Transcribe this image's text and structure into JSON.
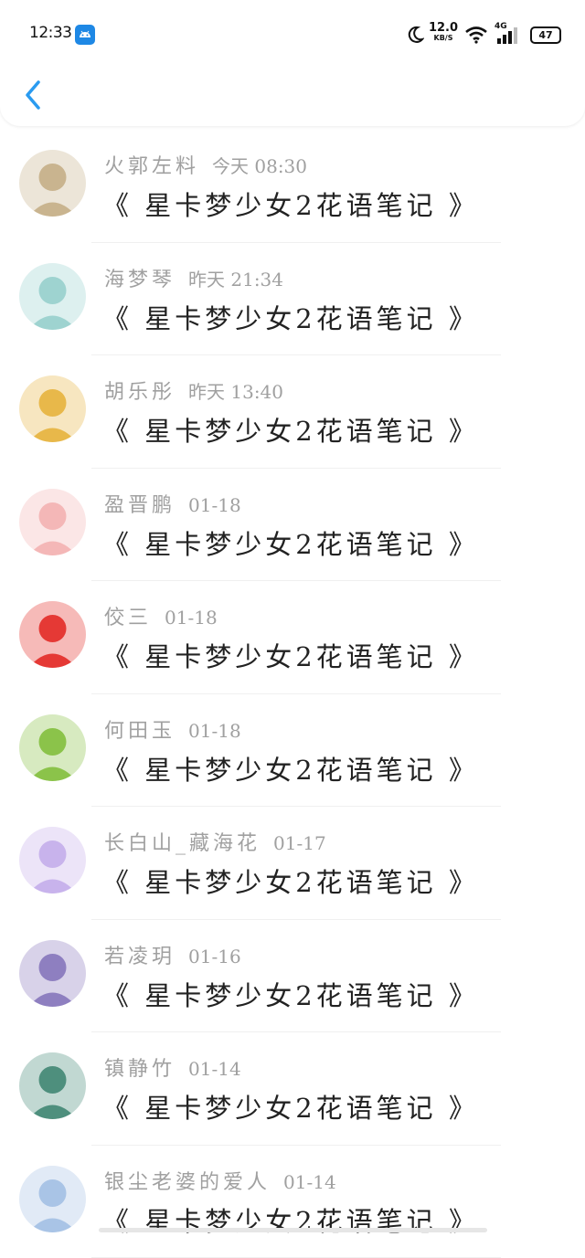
{
  "status_bar": {
    "time": "12:33",
    "net_speed": "12.0",
    "net_unit": "KB/S",
    "network_type": "4G",
    "battery": "47",
    "icons": [
      "android-app-icon",
      "moon-icon",
      "wifi-icon",
      "signal-icon",
      "battery-icon"
    ]
  },
  "header": {
    "back_icon": "chevron-left-icon",
    "accent": "#2a9bf0"
  },
  "messages": [
    {
      "name": "火郭左料",
      "date": "今天 08:30",
      "title": "《 星卡梦少女2花语笔记 》",
      "avatar_color": "#c9b48f"
    },
    {
      "name": "海梦琴",
      "date": "昨天 21:34",
      "title": "《 星卡梦少女2花语笔记 》",
      "avatar_color": "#9ed3d0"
    },
    {
      "name": "胡乐彤",
      "date": "昨天 13:40",
      "title": "《 星卡梦少女2花语笔记 》",
      "avatar_color": "#e8b84a"
    },
    {
      "name": "盈晋鹏",
      "date": "01-18",
      "title": "《 星卡梦少女2花语笔记 》",
      "avatar_color": "#f4b7b7"
    },
    {
      "name": "佼三",
      "date": "01-18",
      "title": "《 星卡梦少女2花语笔记 》",
      "avatar_color": "#e53935"
    },
    {
      "name": "何田玉",
      "date": "01-18",
      "title": "《 星卡梦少女2花语笔记 》",
      "avatar_color": "#8bc34a"
    },
    {
      "name": "长白山_藏海花",
      "date": "01-17",
      "title": "《 星卡梦少女2花语笔记 》",
      "avatar_color": "#c8b3ec"
    },
    {
      "name": "若凌玥",
      "date": "01-16",
      "title": "《 星卡梦少女2花语笔记 》",
      "avatar_color": "#8e7fc0"
    },
    {
      "name": "镇静竹",
      "date": "01-14",
      "title": "《 星卡梦少女2花语笔记 》",
      "avatar_color": "#4e8f7d"
    },
    {
      "name": "银尘老婆的爱人",
      "date": "01-14",
      "title": "《 星卡梦少女2花语笔记 》",
      "avatar_color": "#a9c4e6"
    }
  ]
}
